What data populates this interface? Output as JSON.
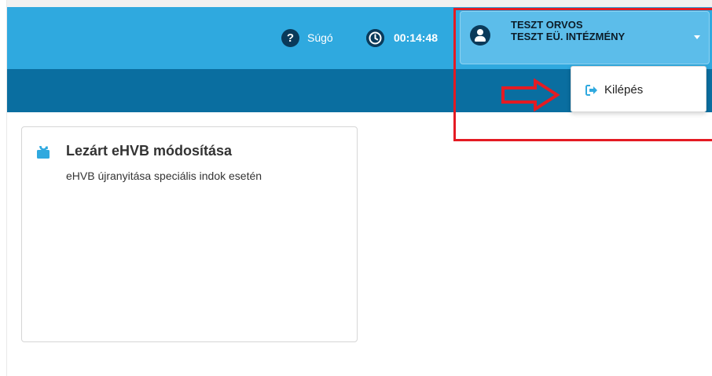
{
  "header": {
    "help_label": "Súgó",
    "help_icon": "question-circle-icon",
    "session_timer": "00:14:48",
    "timer_icon": "clock-icon",
    "user": {
      "name": "TESZT ORVOS",
      "institution": "TESZT EÜ. INTÉZMÉNY",
      "avatar_icon": "user-circle-icon",
      "caret_icon": "caret-down-icon"
    },
    "colors": {
      "topbar": "#2fa9df",
      "subbar": "#0a6ea0",
      "user_box": "#5cbdea",
      "highlight": "#e41b23"
    }
  },
  "user_menu": {
    "items": [
      {
        "label": "Kilépés",
        "icon": "sign-out-icon"
      }
    ]
  },
  "cards": [
    {
      "title": "Lezárt eHVB módosítása",
      "description": "eHVB újranyitása speciális indok esetén",
      "icon": "unlock-icon"
    }
  ]
}
